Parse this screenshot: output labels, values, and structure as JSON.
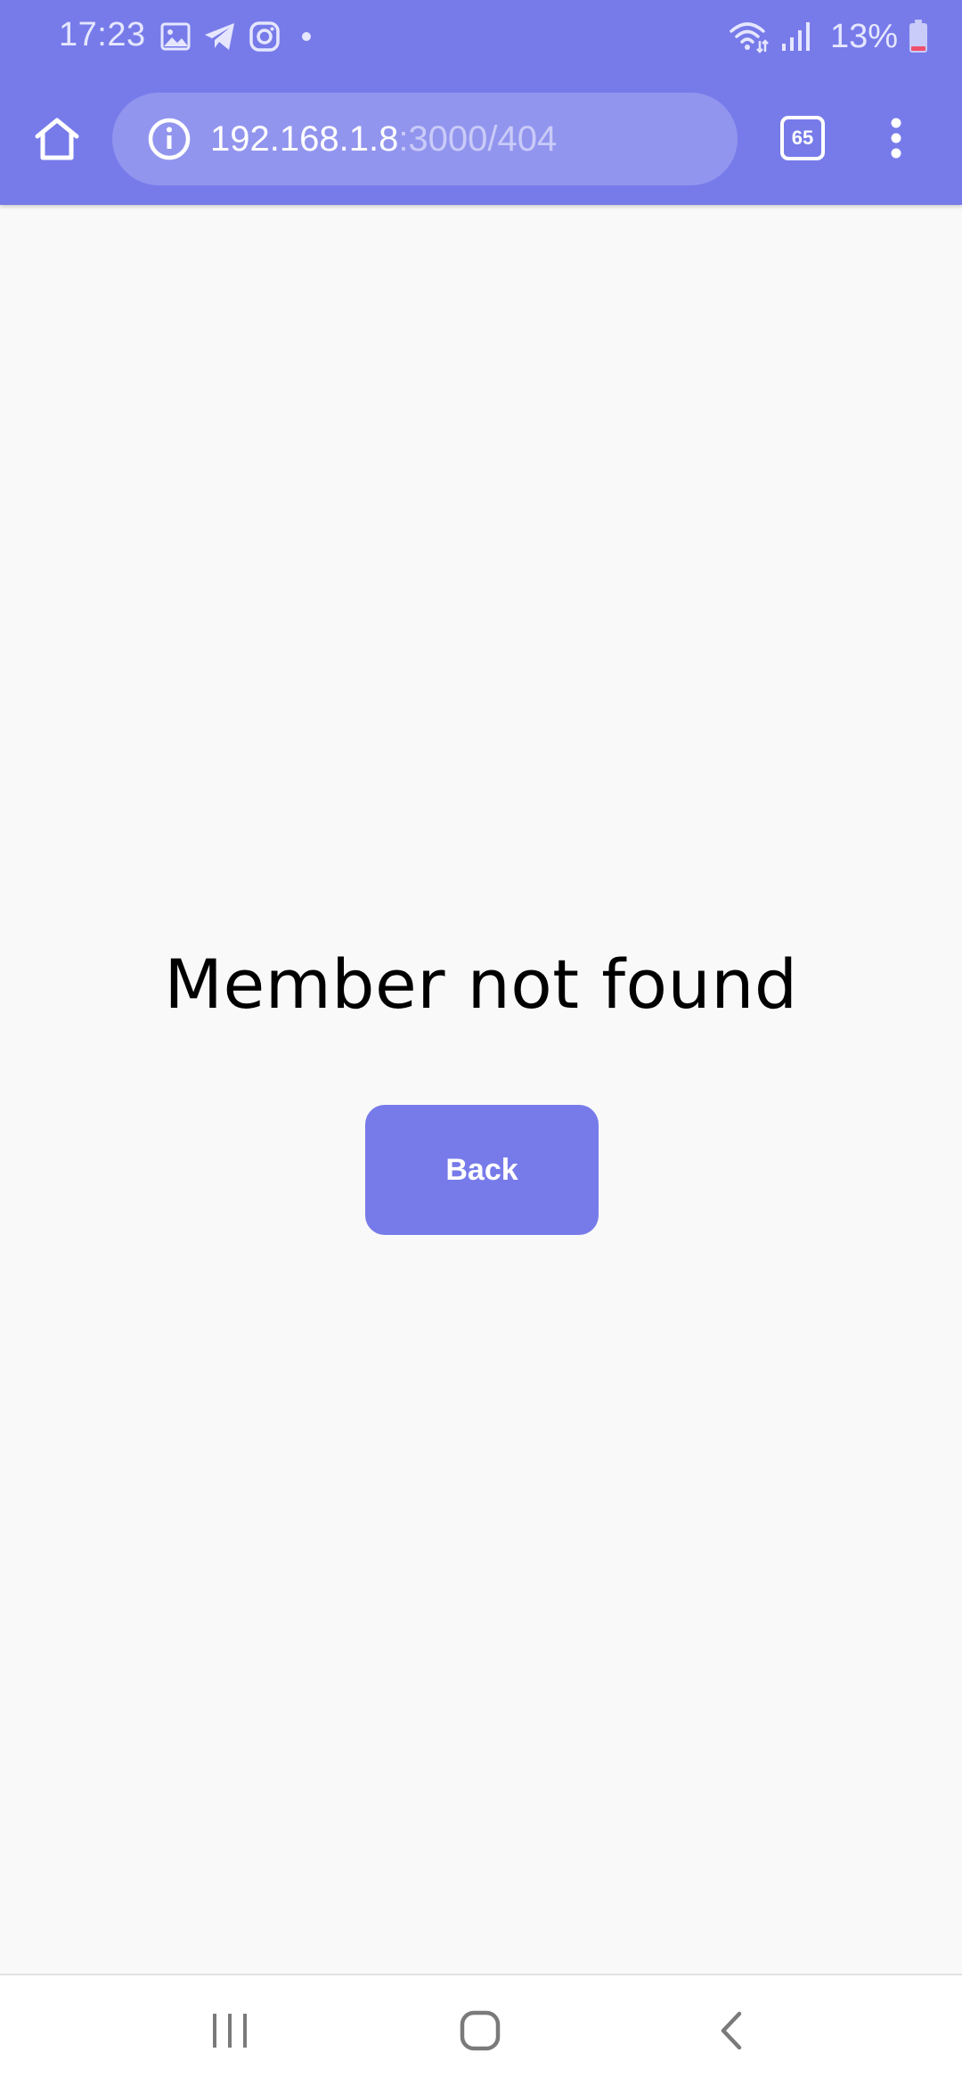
{
  "status_bar": {
    "time": "17:23",
    "battery_percent": "13%",
    "icons_left": [
      "gallery-icon",
      "telegram-icon",
      "instagram-icon",
      "notification-dot-icon"
    ],
    "icons_right": [
      "wifi-icon",
      "signal-icon",
      "battery-icon"
    ]
  },
  "browser": {
    "url_host": "192.168.1.8",
    "url_path": ":3000/404",
    "tab_count": "65",
    "theme_color": "#777be9"
  },
  "page": {
    "title": "Member not found",
    "back_label": "Back",
    "background_color": "#f9f9f9",
    "button_color": "#777be9"
  },
  "nav_bar": {
    "buttons": [
      "recents-icon",
      "home-icon",
      "back-icon"
    ]
  }
}
